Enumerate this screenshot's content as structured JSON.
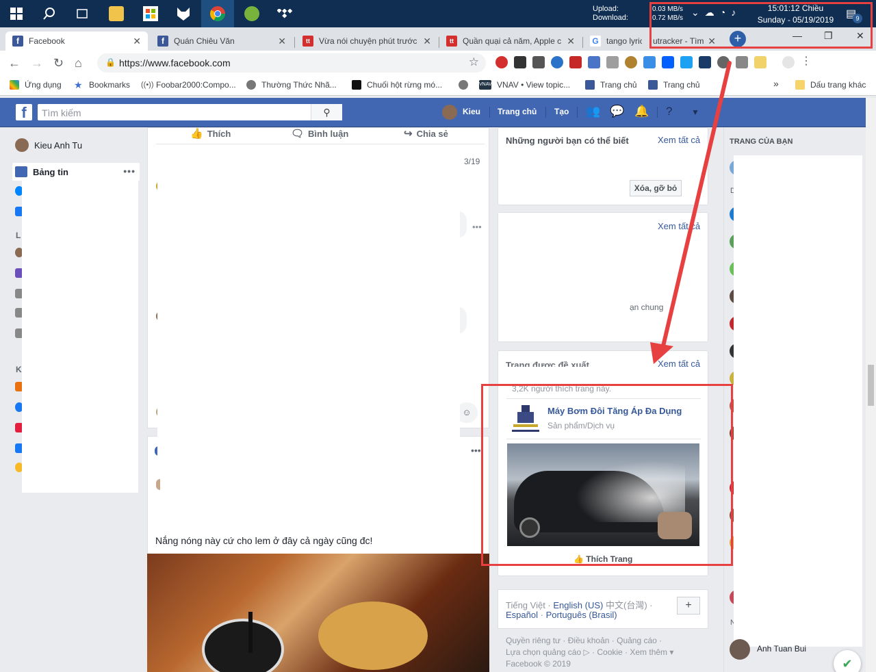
{
  "taskbar": {
    "upload_label": "Upload:",
    "download_label": "Download:",
    "upload_value": "0.03 MB/s",
    "download_value": "0.72 MB/s",
    "clock_time": "15:01:12 Chiều",
    "clock_date": "Sunday - 05/19/2019",
    "notification_count": "9"
  },
  "tabs": [
    {
      "title": "Facebook",
      "favicon": "facebook-icon",
      "color": "#3b5998"
    },
    {
      "title": "Quán Chiêu Văn",
      "favicon": "facebook-icon",
      "color": "#3b5998"
    },
    {
      "title": "Vừa nói chuyện phút trước",
      "favicon": "tinhte-icon",
      "color": "#d32f2f"
    },
    {
      "title": "Quần quại cả năm, Apple c",
      "favicon": "tinhte-icon",
      "color": "#d32f2f"
    },
    {
      "title": "tango lyrico",
      "favicon": "google-icon",
      "color": "#4285f4"
    },
    {
      "title": "utracker - Tìm",
      "favicon": "",
      "color": ""
    }
  ],
  "address_bar": {
    "url": "https://www.facebook.com"
  },
  "bookmarks": [
    {
      "label": "Ứng dụng"
    },
    {
      "label": "Bookmarks"
    },
    {
      "label": "Foobar2000:Compo..."
    },
    {
      "label": "Thường Thức Nhã..."
    },
    {
      "label": "Chuối hột rừng mó..."
    },
    {
      "label": ""
    },
    {
      "label": "VNAV • View topic..."
    },
    {
      "label": "Trang chủ"
    },
    {
      "label": "Trang chủ"
    },
    {
      "label": "»"
    },
    {
      "label": "Dấu trang khác"
    }
  ],
  "fb_header": {
    "search_placeholder": "Tìm kiếm",
    "user_name": "Kieu",
    "home_label": "Trang chủ",
    "create_label": "Tạo"
  },
  "left_nav": {
    "user_name": "Kieu Anh Tu",
    "news_feed": "Bảng tin",
    "partial_letters": [
      "L",
      "K"
    ]
  },
  "feed": {
    "like_label": "Thích",
    "comment_label": "Bình luận",
    "share_label": "Chia sẻ",
    "date": "3/19",
    "post_text": "Nắng nóng này cứ cho lem ở đây cả ngày cũng đc!"
  },
  "right_col": {
    "pymk_title": "Những người bạn có thể biết",
    "see_all_1": "Xem tất cả",
    "remove_button": "Xóa, gỡ bỏ",
    "see_all_2": "Xem tất cả",
    "mutual_text": "ạn chung",
    "suggested_title": "Trang được đề xuất",
    "see_all_3": "Xem tất cả",
    "likes_count": "3,2K người thích trang này.",
    "page_name": "Máy Bơm Đôi Tăng Áp Đa Dụng",
    "page_category": "Sản phẩm/Dịch vụ",
    "like_page": "Thích Trang"
  },
  "languages": {
    "current": "Tiếng Việt ·",
    "lang1": "English (US)",
    "lang2": "中文(台灣) ·",
    "lang3": "Español",
    "lang4": "Português (Brasil)",
    "add_label": "+"
  },
  "footer": {
    "line1": "Quyền riêng tư · Điều khoản · Quảng cáo ·",
    "line2": "Lựa chọn quảng cáo ▷ · Cookie · Xem thêm ▾",
    "line3": "Facebook © 2019"
  },
  "far_right": {
    "pages_title": "TRANG CỦA BẠN",
    "partial_name": "Anh Tuan Bui",
    "partial_letters": [
      "D",
      "N"
    ]
  },
  "colors": {
    "fb_blue": "#4267b2",
    "annotation_red": "#e74040",
    "taskbar": "#0f2e52"
  }
}
